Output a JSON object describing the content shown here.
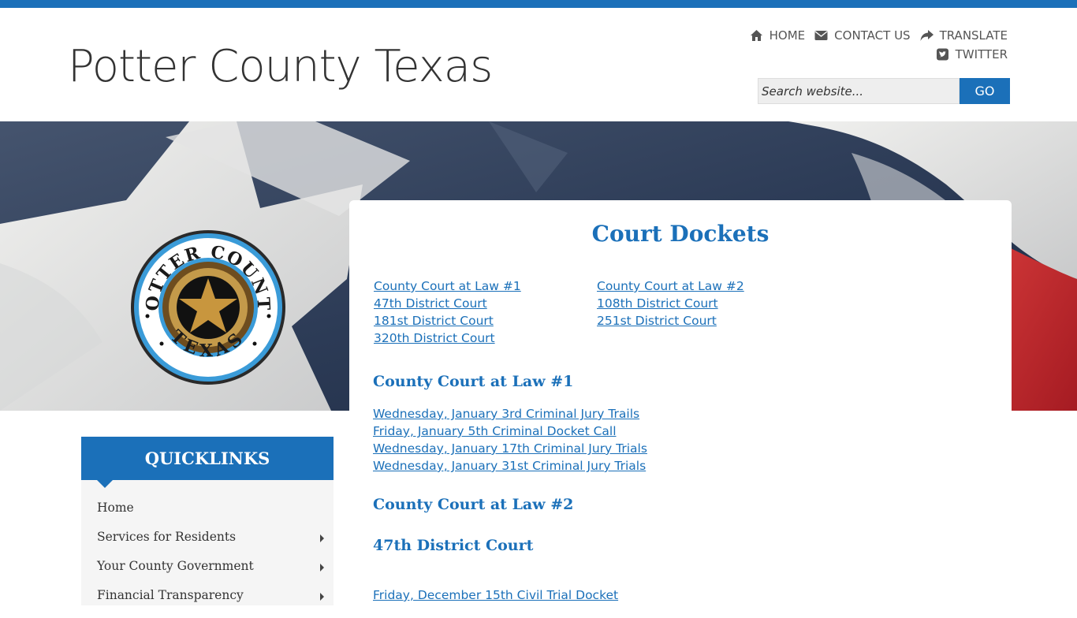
{
  "header": {
    "site_title": "Potter County Texas",
    "nav": [
      {
        "label": "HOME",
        "icon": "home-icon"
      },
      {
        "label": "CONTACT US",
        "icon": "envelope-icon"
      },
      {
        "label": "TRANSLATE",
        "icon": "share-arrow-icon"
      },
      {
        "label": "TWITTER",
        "icon": "twitter-square-icon"
      }
    ],
    "search": {
      "placeholder": "Search website...",
      "button": "GO"
    }
  },
  "seal": {
    "top_text": "POTTER COUNTY",
    "bottom_text": "TEXAS"
  },
  "main": {
    "title": "Court Dockets",
    "court_links_col1": [
      "County Court at Law #1",
      "47th District Court",
      "181st District Court",
      "320th District Court"
    ],
    "court_links_col2": [
      "County Court at Law #2",
      "108th District Court",
      "251st District Court"
    ],
    "sections": [
      {
        "heading": "County Court at Law #1",
        "links": [
          "Wednesday, January 3rd Criminal Jury Trails",
          "Friday, January 5th Criminal Docket Call",
          "Wednesday, January 17th Criminal Jury Trials",
          "Wednesday, January 31st Criminal Jury Trials"
        ]
      },
      {
        "heading": "County Court at Law #2",
        "links": []
      },
      {
        "heading": "47th District Court",
        "links": [
          "Friday, December 15th Civil Trial Docket"
        ]
      }
    ]
  },
  "quicklinks": {
    "title": "QUICKLINKS",
    "items": [
      {
        "label": "Home",
        "has_submenu": false
      },
      {
        "label": "Services for Residents",
        "has_submenu": true
      },
      {
        "label": "Your County Government",
        "has_submenu": true
      },
      {
        "label": "Financial Transparency",
        "has_submenu": true
      }
    ]
  },
  "colors": {
    "accent": "#1b70b9",
    "text": "#333333"
  }
}
